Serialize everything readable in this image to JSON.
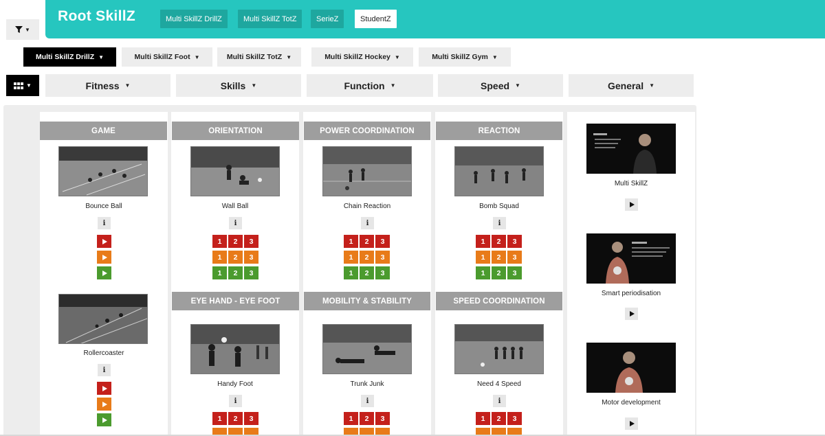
{
  "app": {
    "title": "Root SkillZ"
  },
  "top_tabs": [
    {
      "label": "Multi SkillZ DrillZ",
      "active": false
    },
    {
      "label": "Multi SkillZ TotZ",
      "active": false
    },
    {
      "label": "SerieZ",
      "active": false
    },
    {
      "label": "StudentZ",
      "active": true
    }
  ],
  "categories": [
    {
      "label": "Multi SkillZ DrillZ",
      "active": true
    },
    {
      "label": "Multi SkillZ Foot",
      "active": false
    },
    {
      "label": "Multi SkillZ TotZ",
      "active": false
    },
    {
      "label": "Multi SkillZ Hockey",
      "active": false
    },
    {
      "label": "Multi SkillZ Gym",
      "active": false
    }
  ],
  "filters": [
    {
      "label": "Fitness"
    },
    {
      "label": "Skills"
    },
    {
      "label": "Function"
    },
    {
      "label": "Speed"
    },
    {
      "label": "General"
    }
  ],
  "levels": [
    "1",
    "2",
    "3"
  ],
  "info_label": "i",
  "sections": [
    {
      "title": "GAME",
      "drills": [
        {
          "name": "Bounce Ball"
        },
        {
          "name": "Rollercoaster"
        }
      ]
    },
    {
      "title": "ORIENTATION",
      "drills": [
        {
          "name": "Wall Ball"
        }
      ]
    },
    {
      "title": "POWER COORDINATION",
      "drills": [
        {
          "name": "Chain Reaction"
        }
      ]
    },
    {
      "title": "REACTION",
      "drills": [
        {
          "name": "Bomb Squad"
        }
      ]
    },
    {
      "title": "EYE HAND - EYE FOOT",
      "drills": [
        {
          "name": "Handy Foot"
        }
      ]
    },
    {
      "title": "MOBILITY & STABILITY",
      "drills": [
        {
          "name": "Trunk Junk"
        }
      ]
    },
    {
      "title": "SPEED COORDINATION",
      "drills": [
        {
          "name": "Need 4 Speed"
        }
      ]
    }
  ],
  "videos": [
    {
      "title": "Multi SkillZ"
    },
    {
      "title": "Smart periodisation"
    },
    {
      "title": "Motor development"
    }
  ],
  "colors": {
    "header": "#26c6bf",
    "level_red": "#c4201b",
    "level_orange": "#e87b19",
    "level_green": "#4b9b2e",
    "section_header": "#9e9e9e"
  },
  "icons": [
    "filter-icon",
    "chevron-down-icon",
    "grid-view-icon",
    "play-icon",
    "info-icon"
  ]
}
